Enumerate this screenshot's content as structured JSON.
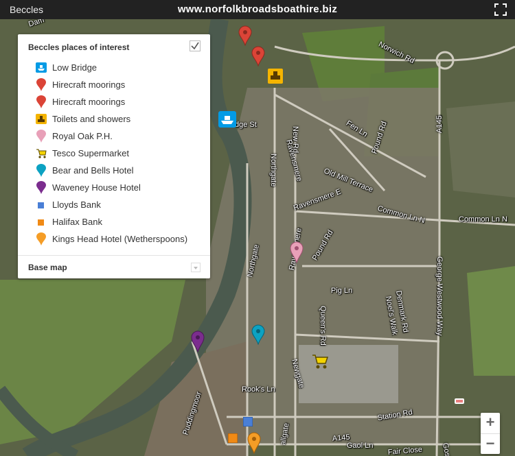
{
  "header": {
    "title": "Beccles",
    "site": "www.norfolkbroadsboathire.biz"
  },
  "panel": {
    "title": "Beccles places of interest",
    "base_map_label": "Base map",
    "items": [
      {
        "label": "Low Bridge",
        "icon": "boat-icon",
        "color": "#039be5"
      },
      {
        "label": "Hirecraft moorings",
        "icon": "red-pin-icon",
        "color": "#db4437"
      },
      {
        "label": "Hirecraft moorings",
        "icon": "red-pin-icon",
        "color": "#db4437"
      },
      {
        "label": "Toilets and showers",
        "icon": "toilet-icon",
        "color": "#f4b400"
      },
      {
        "label": "Royal Oak P.H.",
        "icon": "pink-pin-icon",
        "color": "#e8a0b8"
      },
      {
        "label": "Tesco Supermarket",
        "icon": "cart-icon",
        "color": "#f4d300"
      },
      {
        "label": "Bear and Bells Hotel",
        "icon": "teal-pin-icon",
        "color": "#0ca2c2"
      },
      {
        "label": "Waveney House Hotel",
        "icon": "purple-pin-icon",
        "color": "#7b2d8e"
      },
      {
        "label": "Lloyds Bank",
        "icon": "blue-square-icon",
        "color": "#4a7fd6"
      },
      {
        "label": "Halifax Bank",
        "icon": "orange-square-icon",
        "color": "#f08a16"
      },
      {
        "label": "Kings Head Hotel (Wetherspoons)",
        "icon": "orange-pin-icon",
        "color": "#f59d26"
      }
    ]
  },
  "map_labels": {
    "dam": "Dam",
    "norwich_rd": "Norwich Rd",
    "fen_ln": "Fen Ln",
    "new_rd": "New Rd",
    "bridge_st": "dge St",
    "northgate": "Northgate",
    "northgate_2": "Northgate",
    "ravensmere": "Ravensmere",
    "ravensmere_2": "Ravensmere",
    "ravensmere_e": "Ravensmere E",
    "old_mill": "Old Mill Terrace",
    "pound_rd": "Pound Rd",
    "pound_rd_2": "Pound Rd",
    "a145": "A145",
    "common_ln_n": "Common Ln N",
    "common_ln_n_2": "Common Ln N",
    "george_westwood": "George Westwood Way",
    "pig_ln": "Pig Ln",
    "queens_rd": "Queen's Rd",
    "noels_walk": "Noel's Walk",
    "denmark_rd": "Denmark Rd",
    "puddingmoor": "Puddingmoor",
    "rooks_ln": "Rook's Ln",
    "newgate": "Newgate",
    "a145_2": "A145",
    "station_rd": "Station Rd",
    "gaol_ln": "Gaol Ln",
    "ballgate": "allgate",
    "fair_close": "Fair Close",
    "gosford": "Gosf"
  },
  "zoom": {
    "in": "+",
    "out": "−"
  }
}
